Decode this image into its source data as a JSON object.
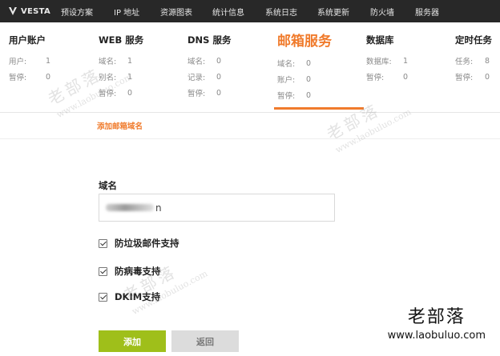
{
  "nav": {
    "logo": "VESTA",
    "items": [
      "预设方案",
      "IP 地址",
      "资源图表",
      "统计信息",
      "系统日志",
      "系统更新",
      "防火墙",
      "服务器"
    ]
  },
  "cards": [
    {
      "title": "用户账户",
      "stats": [
        {
          "k": "用户:",
          "v": "1"
        },
        {
          "k": "暂停:",
          "v": "0"
        }
      ]
    },
    {
      "title": "WEB 服务",
      "stats": [
        {
          "k": "域名:",
          "v": "1"
        },
        {
          "k": "别名:",
          "v": "1"
        },
        {
          "k": "暂停:",
          "v": "0"
        }
      ]
    },
    {
      "title": "DNS 服务",
      "stats": [
        {
          "k": "域名:",
          "v": "0"
        },
        {
          "k": "记录:",
          "v": "0"
        },
        {
          "k": "暂停:",
          "v": "0"
        }
      ]
    },
    {
      "title": "邮箱服务",
      "stats": [
        {
          "k": "域名:",
          "v": "0"
        },
        {
          "k": "账户:",
          "v": "0"
        },
        {
          "k": "暂停:",
          "v": "0"
        }
      ]
    },
    {
      "title": "数据库",
      "stats": [
        {
          "k": "数据库:",
          "v": "1"
        },
        {
          "k": "暂停:",
          "v": "0"
        }
      ]
    },
    {
      "title": "定时任务",
      "stats": [
        {
          "k": "任务:",
          "v": "8"
        },
        {
          "k": "暂停:",
          "v": "0"
        }
      ]
    }
  ],
  "active_card": "邮箱服务",
  "add_link": "添加邮箱域名",
  "form": {
    "domain_label": "域名",
    "domain_value_suffix": "n",
    "checkboxes": [
      {
        "label": "防垃圾邮件支持",
        "checked": true
      },
      {
        "label": "防病毒支持",
        "checked": true
      },
      {
        "label": "DKIM支持",
        "checked": true
      }
    ],
    "add_button": "添加",
    "back_button": "返回"
  },
  "watermark": {
    "cn": "老部落",
    "url": "www.laobuluo.com"
  },
  "colors": {
    "accent": "#f07b2c",
    "nav_bg": "#282828",
    "add_button": "#9fbf1a",
    "back_button": "#dcdcdc"
  }
}
